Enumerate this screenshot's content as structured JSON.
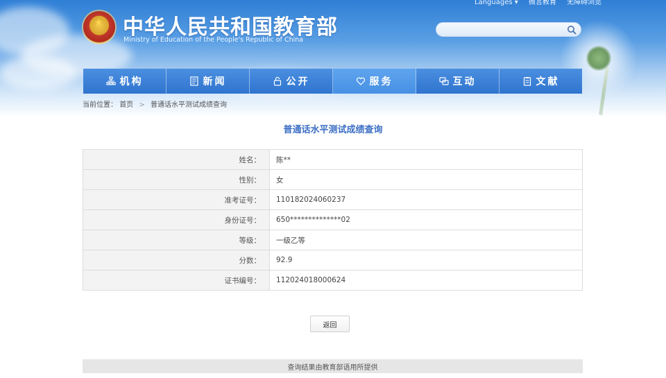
{
  "header": {
    "site_title": "中华人民共和国教育部",
    "site_subtitle": "Ministry of Education of the People's Republic of China",
    "top_links": [
      "Languages ▾",
      "微言教育",
      "无障碍浏览"
    ],
    "search": {
      "placeholder": "",
      "value": ""
    }
  },
  "nav": {
    "items": [
      {
        "label": "机构",
        "icon": "org-chart-icon"
      },
      {
        "label": "新闻",
        "icon": "news-icon"
      },
      {
        "label": "公开",
        "icon": "lock-icon"
      },
      {
        "label": "服务",
        "icon": "heart-icon",
        "active": true
      },
      {
        "label": "互动",
        "icon": "chat-icon"
      },
      {
        "label": "文献",
        "icon": "document-icon"
      }
    ]
  },
  "breadcrumb": {
    "prefix": "当前位置：",
    "items": [
      "首页",
      "普通话水平测试成绩查询"
    ],
    "separator": ">"
  },
  "page": {
    "title": "普通话水平测试成绩查询",
    "rows": [
      {
        "label": "姓名：",
        "value": "陈**"
      },
      {
        "label": "性别：",
        "value": "女"
      },
      {
        "label": "准考证号：",
        "value": "110182024060237"
      },
      {
        "label": "身份证号：",
        "value": "650**************02"
      },
      {
        "label": "等级：",
        "value": "一级乙等"
      },
      {
        "label": "分数：",
        "value": "92.9"
      },
      {
        "label": "证书编号：",
        "value": "112024018000624"
      }
    ],
    "back_label": "返回"
  },
  "footer": {
    "text": "查询结果由教育部语用所提供"
  },
  "colors": {
    "nav_blue": "#2f74cf",
    "nav_active": "#4690e4",
    "title_blue": "#3c6fc4",
    "label_bg": "#f3f3f3",
    "footer_bg": "#e6e6e6"
  }
}
